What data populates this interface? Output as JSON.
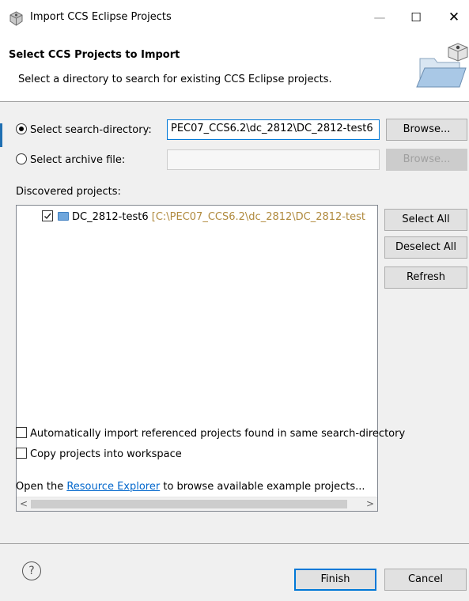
{
  "window": {
    "title": "Import CCS Eclipse Projects",
    "min_label": "—",
    "max_label": "☐",
    "close_label": "✕"
  },
  "header": {
    "title": "Select CCS Projects to Import",
    "description": "Select a directory to search for existing CCS Eclipse projects."
  },
  "source": {
    "directory_radio_label": "Select search-directory:",
    "directory_selected": true,
    "directory_value": "PEC07_CCS6.2\\dc_2812\\DC_2812-test6",
    "browse_label": "Browse...",
    "archive_radio_label": "Select archive file:",
    "archive_value": "",
    "archive_browse_label": "Browse..."
  },
  "projects": {
    "label": "Discovered projects:",
    "items": [
      {
        "name": "DC_2812-test6",
        "path": "[C:\\PEC07_CCS6.2\\dc_2812\\DC_2812-test",
        "checked": true
      }
    ],
    "select_all_label": "Select All",
    "deselect_all_label": "Deselect All",
    "refresh_label": "Refresh",
    "scroll_left": "<",
    "scroll_right": ">"
  },
  "options": {
    "auto_import_label": "Automatically import referenced projects found in same search-directory",
    "auto_import_checked": false,
    "copy_label": "Copy projects into workspace",
    "copy_checked": false
  },
  "resource": {
    "prefix": "Open the ",
    "link": "Resource Explorer",
    "suffix": " to browse available example projects..."
  },
  "footer": {
    "help_label": "?",
    "finish_label": "Finish",
    "cancel_label": "Cancel"
  },
  "icons": {
    "app": "ccs-app-icon",
    "header_art": "import-folder-icon",
    "folder": "project-folder-icon",
    "help": "help-icon"
  },
  "colors": {
    "accent": "#0078d7",
    "link": "#0066cc",
    "path_text": "#b08a3e",
    "panel_bg": "#f0f0f0"
  }
}
